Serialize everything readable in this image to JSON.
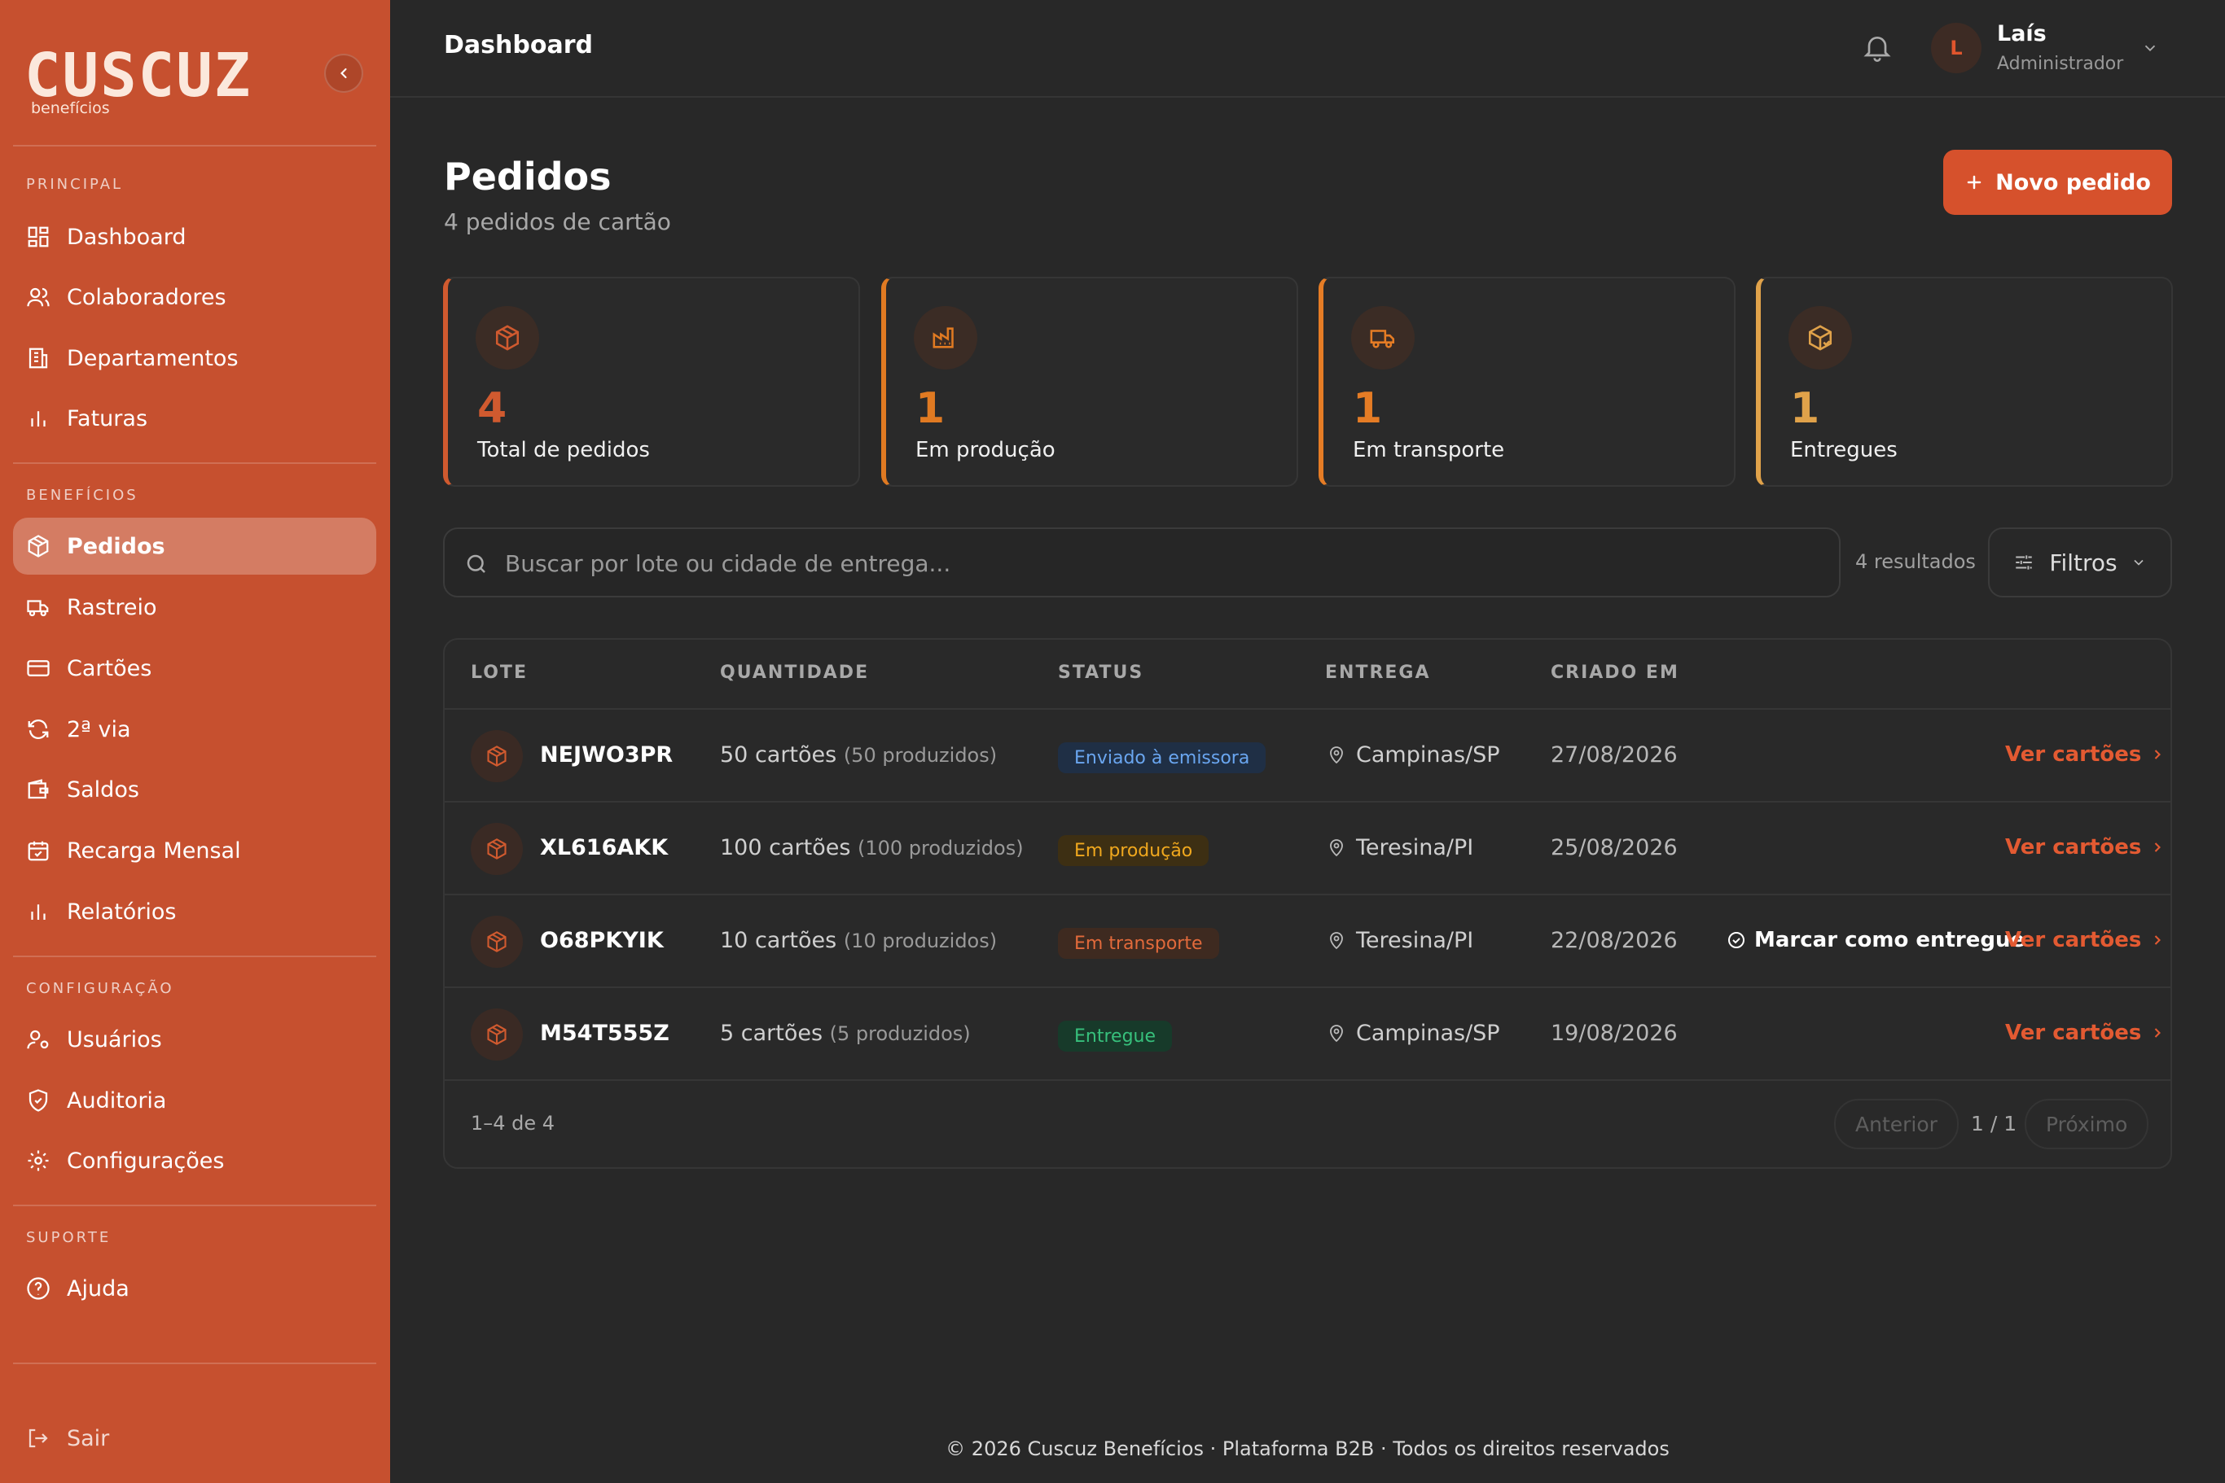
{
  "brand": {
    "logo_text": "CUSCUZ",
    "logo_sub": "benefícios"
  },
  "sidebar": {
    "sections": [
      {
        "title": "PRINCIPAL",
        "items": [
          "Dashboard",
          "Colaboradores",
          "Departamentos",
          "Faturas"
        ]
      },
      {
        "title": "BENEFÍCIOS",
        "items": [
          "Pedidos",
          "Rastreio",
          "Cartões",
          "2ª via",
          "Saldos",
          "Recarga Mensal",
          "Relatórios"
        ]
      },
      {
        "title": "CONFIGURAÇÃO",
        "items": [
          "Usuários",
          "Auditoria",
          "Configurações"
        ]
      },
      {
        "title": "SUPORTE",
        "items": [
          "Ajuda"
        ]
      }
    ],
    "active_item": "Pedidos",
    "logout": "Sair"
  },
  "topbar": {
    "title": "Dashboard",
    "user": {
      "initial": "L",
      "name": "Laís",
      "role": "Administrador"
    }
  },
  "header": {
    "title": "Pedidos",
    "subtitle": "4 pedidos de cartão",
    "new_button": "Novo pedido"
  },
  "stats": [
    {
      "value": "4",
      "label": "Total de pedidos",
      "icon": "package-icon",
      "color": "#d05a2f"
    },
    {
      "value": "1",
      "label": "Em produção",
      "icon": "factory-icon",
      "color": "#e07a22"
    },
    {
      "value": "1",
      "label": "Em transporte",
      "icon": "truck-icon",
      "color": "#e57c25"
    },
    {
      "value": "1",
      "label": "Entregues",
      "icon": "package-check-icon",
      "color": "#e0a24a"
    }
  ],
  "search": {
    "placeholder": "Buscar por lote ou cidade de entrega...",
    "results": "4 resultados",
    "filters": "Filtros"
  },
  "table": {
    "headers": [
      "LOTE",
      "QUANTIDADE",
      "STATUS",
      "ENTREGA",
      "CRIADO EM"
    ],
    "rows": [
      {
        "lot": "NEJWO3PR",
        "qty": "50 cartões",
        "produced": "(50 produzidos)",
        "status": "Enviado à emissora",
        "city": "Campinas/SP",
        "date": "27/08/2026",
        "mark": "",
        "action": "Ver cartões"
      },
      {
        "lot": "XL616AKK",
        "qty": "100 cartões",
        "produced": "(100 produzidos)",
        "status": "Em produção",
        "city": "Teresina/PI",
        "date": "25/08/2026",
        "mark": "",
        "action": "Ver cartões"
      },
      {
        "lot": "O68PKYIK",
        "qty": "10 cartões",
        "produced": "(10 produzidos)",
        "status": "Em transporte",
        "city": "Teresina/PI",
        "date": "22/08/2026",
        "mark": "Marcar como entregue",
        "action": "Ver cartões"
      },
      {
        "lot": "M54T555Z",
        "qty": "5 cartões",
        "produced": "(5 produzidos)",
        "status": "Entregue",
        "city": "Campinas/SP",
        "date": "19/08/2026",
        "mark": "",
        "action": "Ver cartões"
      }
    ]
  },
  "status_colors": {
    "Enviado à emissora": {
      "bg": "#1f2f45",
      "fg": "#6aa6f0"
    },
    "Em produção": {
      "bg": "#3d2f13",
      "fg": "#f0a81e"
    },
    "Em transporte": {
      "bg": "#3e2a20",
      "fg": "#e26a3b"
    },
    "Entregue": {
      "bg": "#173a2a",
      "fg": "#37c07c"
    }
  },
  "pagination": {
    "info": "1–4 de 4",
    "prev": "Anterior",
    "page": "1 / 1",
    "next": "Próximo"
  },
  "footer": "© 2026 Cuscuz Benefícios · Plataforma B2B · Todos os direitos reservados"
}
